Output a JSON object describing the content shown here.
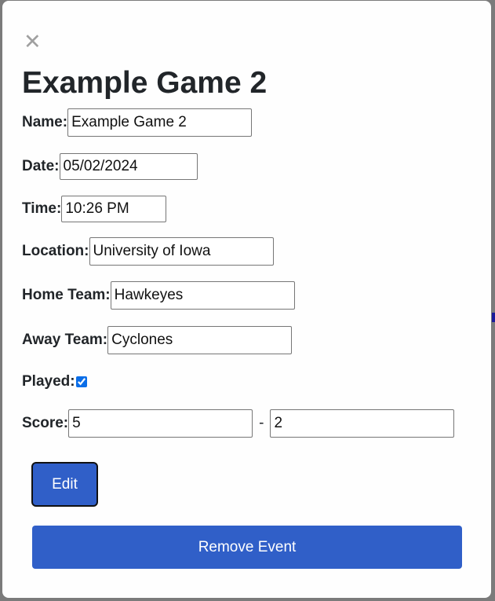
{
  "modal": {
    "title": "Example Game 2",
    "close_icon": "close-icon"
  },
  "form": {
    "name": {
      "label": "Name:",
      "value": "Example Game 2"
    },
    "date": {
      "label": "Date:",
      "value": "05/02/2024"
    },
    "time": {
      "label": "Time:",
      "value": "10:26 PM"
    },
    "location": {
      "label": "Location:",
      "value": "University of Iowa"
    },
    "home_team": {
      "label": "Home Team:",
      "value": "Hawkeyes"
    },
    "away_team": {
      "label": "Away Team:",
      "value": "Cyclones"
    },
    "played": {
      "label": "Played:",
      "checked": true
    },
    "score": {
      "label": "Score:",
      "home": "5",
      "separator": "-",
      "away": "2"
    }
  },
  "actions": {
    "edit_label": "Edit",
    "remove_label": "Remove Event"
  },
  "colors": {
    "button": "#305fc8",
    "checkbox": "#0b6ee8",
    "backdrop": "#7b7b7b"
  }
}
